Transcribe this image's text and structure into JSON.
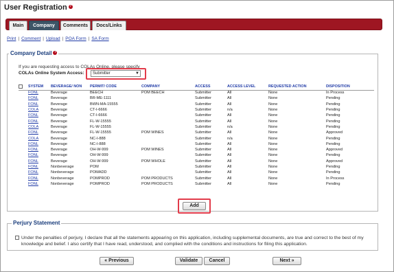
{
  "page": {
    "title": "User Registration"
  },
  "tabs": [
    {
      "label": "Main"
    },
    {
      "label": "Company"
    },
    {
      "label": "Comments"
    },
    {
      "label": "Docs/Links"
    }
  ],
  "links": [
    {
      "label": "Print"
    },
    {
      "label": "Comment"
    },
    {
      "label": "Upload"
    },
    {
      "label": "POA Form"
    },
    {
      "label": "SA Form"
    }
  ],
  "company_detail": {
    "legend": "Company Detail",
    "note": "If you are requesting access to COLAs Online, please specify",
    "access_label": "COLAs Online System Access:",
    "access_value": "Submitter",
    "columns": [
      "SYSTEM",
      "BEVERAGE/ NON",
      "PERMIT/ CODE",
      "COMPANY",
      "ACCESS",
      "ACCESS LEVEL",
      "REQUESTED ACTION",
      "DISPOSITION"
    ],
    "rows": [
      [
        "FONL",
        "Beverage",
        "BEECH",
        "POM BEECH",
        "Submitter",
        "All",
        "None",
        "In Process"
      ],
      [
        "FONL",
        "Beverage",
        "BR-ME-1111",
        "",
        "Submitter",
        "All",
        "None",
        "Pending"
      ],
      [
        "FONL",
        "Beverage",
        "BWN-MA-15555",
        "",
        "Submitter",
        "All",
        "None",
        "Pending"
      ],
      [
        "COLA",
        "Beverage",
        "CT-I-6666",
        "",
        "Submitter",
        "n/a",
        "None",
        "Pending"
      ],
      [
        "FONL",
        "Beverage",
        "CT-I-6666",
        "",
        "Submitter",
        "All",
        "None",
        "Pending"
      ],
      [
        "FONL",
        "Beverage",
        "FL-W-15555",
        "",
        "Submitter",
        "All",
        "None",
        "Pending"
      ],
      [
        "COLA",
        "Beverage",
        "FL-W-15555",
        "",
        "Submitter",
        "n/a",
        "None",
        "Pending"
      ],
      [
        "FONL",
        "Beverage",
        "FL-W-15555",
        "POM WINES",
        "Submitter",
        "All",
        "None",
        "Approved"
      ],
      [
        "COLA",
        "Beverage",
        "NC-I-888",
        "",
        "Submitter",
        "n/a",
        "None",
        "Pending"
      ],
      [
        "FONL",
        "Beverage",
        "NC-I-888",
        "",
        "Submitter",
        "All",
        "None",
        "Pending"
      ],
      [
        "FONL",
        "Beverage",
        "OH-W-999",
        "POM WINES",
        "Submitter",
        "All",
        "None",
        "Approved"
      ],
      [
        "FONL",
        "Beverage",
        "OH-W-999",
        "",
        "Submitter",
        "All",
        "None",
        "Pending"
      ],
      [
        "FONL",
        "Beverage",
        "OH-W-999",
        "POM WHOLE",
        "Submitter",
        "All",
        "None",
        "Approved"
      ],
      [
        "FONL",
        "Nonbeverage",
        "POM",
        "",
        "Submitter",
        "All",
        "None",
        "Pending"
      ],
      [
        "FONL",
        "Nonbeverage",
        "POMADD",
        "",
        "Submitter",
        "All",
        "None",
        "Pending"
      ],
      [
        "FONL",
        "Nonbeverage",
        "POMPROD",
        "POM PRODUCTS",
        "Submitter",
        "All",
        "None",
        "In Process"
      ],
      [
        "FONL",
        "Nonbeverage",
        "POMPROD",
        "POM PRODUCTS",
        "Submitter",
        "All",
        "None",
        "Pending"
      ]
    ],
    "add_label": "Add"
  },
  "perjury": {
    "legend": "Perjury Statement",
    "text": "Under the penalties of perjury, I declare that all the statements appearing on this application, including supplemental documents, are true and correct to the best of my knowledge and belief. I also certify that I have read, understood, and complied with the conditions and instructions for filing this application."
  },
  "footer": {
    "previous": "« Previous",
    "validate": "Validate",
    "cancel": "Cancel",
    "next": "Next »"
  },
  "colors": {
    "tabbar": "#9e1622",
    "active_tab": "#3d5567",
    "link": "#1f3aa6",
    "highlight": "#e23b4a"
  }
}
